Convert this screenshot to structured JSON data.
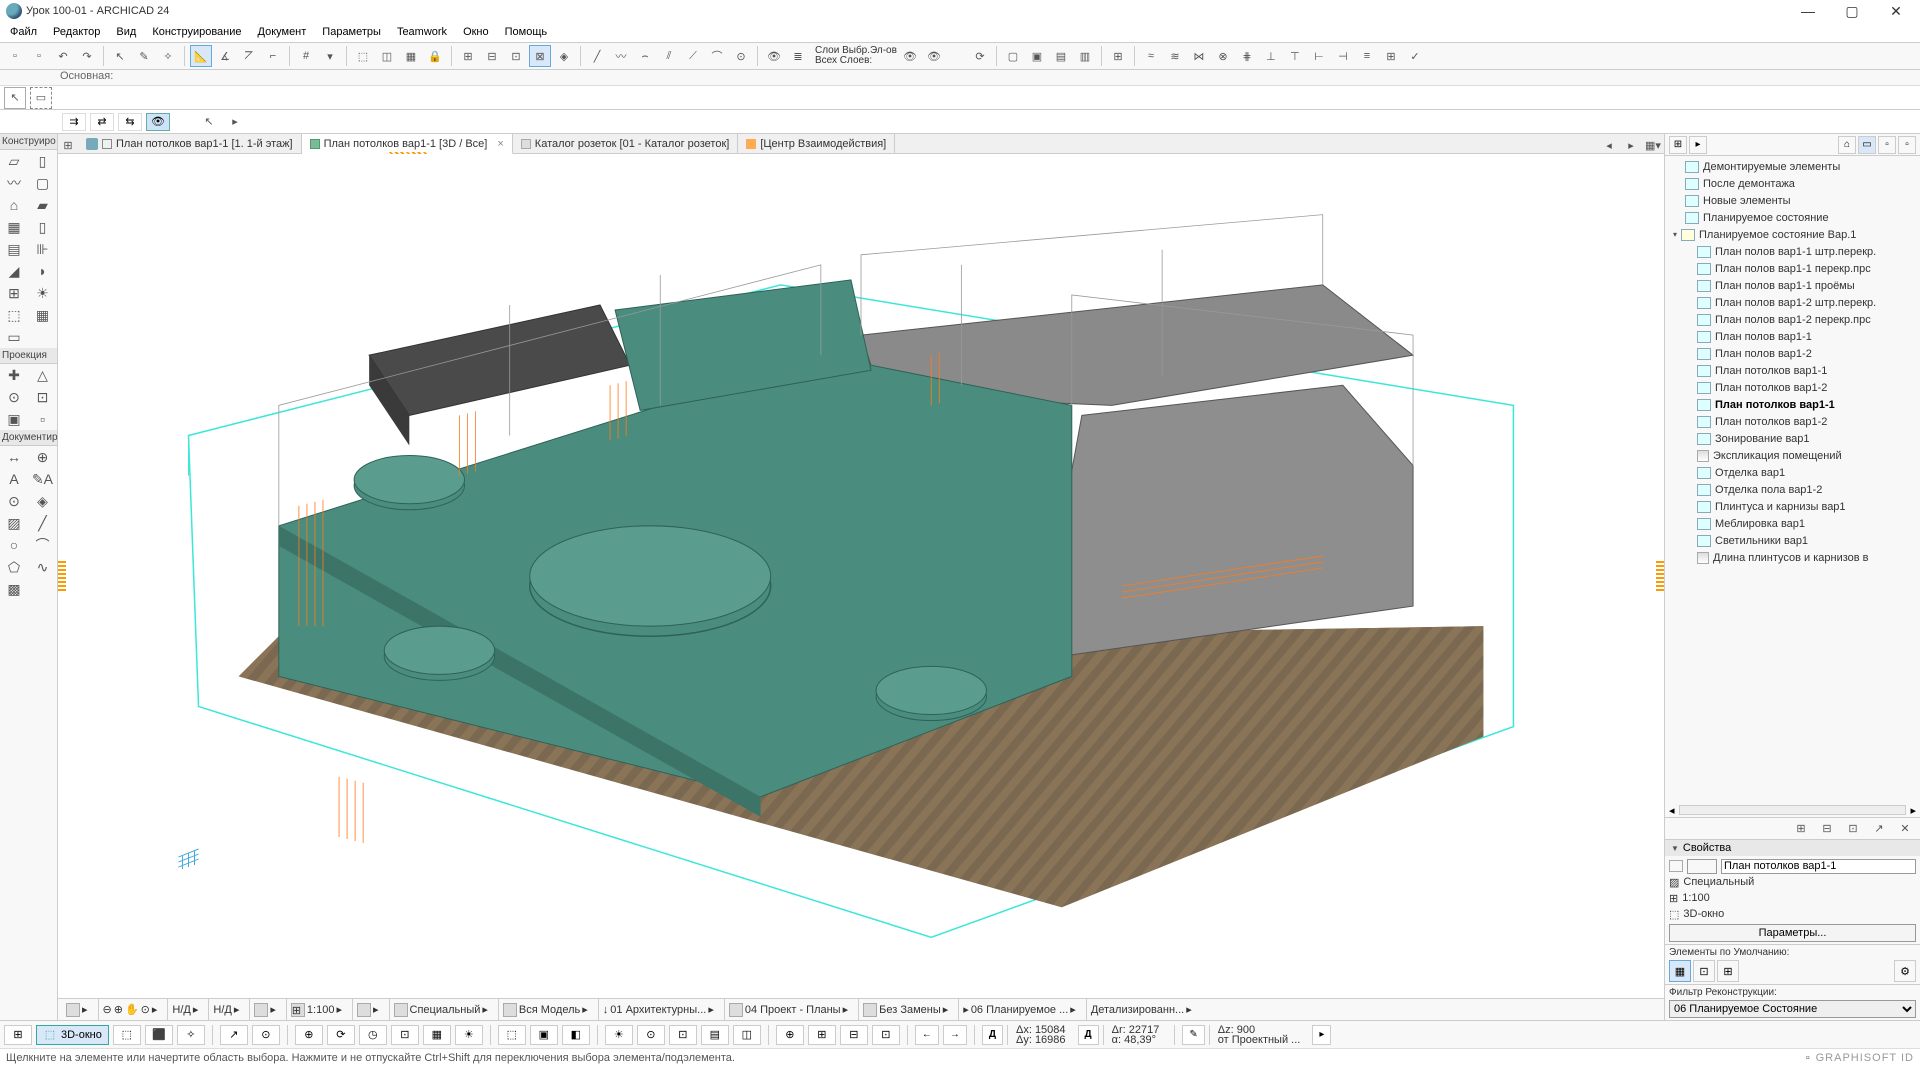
{
  "app": {
    "title": "Урок 100-01 - ARCHICAD 24"
  },
  "menu": [
    "Файл",
    "Редактор",
    "Вид",
    "Конструирование",
    "Документ",
    "Параметры",
    "Teamwork",
    "Окно",
    "Помощь"
  ],
  "toolbar_layers": {
    "l1": "Слои Выбр.Эл-ов",
    "l2": "Всех Слоев:"
  },
  "info_label": "Основная:",
  "tabs": [
    {
      "label": "План потолков вар1-1 [1. 1-й этаж]",
      "active": false
    },
    {
      "label": "План потолков вар1-1 [3D / Все]",
      "active": true
    },
    {
      "label": "Каталог розеток [01 - Каталог розеток]",
      "active": false
    },
    {
      "label": "[Центр Взаимодействия]",
      "active": false
    }
  ],
  "toolbox": {
    "section_construct": "Конструиро",
    "section_projection": "Проекция",
    "section_document": "Документир"
  },
  "navigator": {
    "items": [
      {
        "label": "Демонтируемые элементы",
        "type": "folder",
        "lvl": 2
      },
      {
        "label": "После демонтажа",
        "type": "folder",
        "lvl": 2
      },
      {
        "label": "Новые элементы",
        "type": "folder",
        "lvl": 2
      },
      {
        "label": "Планируемое состояние",
        "type": "folder",
        "lvl": 2
      },
      {
        "label": "Планируемое состояние Вар.1",
        "type": "open",
        "lvl": 1
      },
      {
        "label": "План полов вар1-1 штр.перекр.",
        "type": "folder",
        "lvl": 3
      },
      {
        "label": "План полов вар1-1 перекр.прс",
        "type": "folder",
        "lvl": 3
      },
      {
        "label": "План полов вар1-1 проёмы",
        "type": "folder",
        "lvl": 3
      },
      {
        "label": "План полов вар1-2 штр.перекр.",
        "type": "folder",
        "lvl": 3
      },
      {
        "label": "План полов вар1-2 перекр.прс",
        "type": "folder",
        "lvl": 3
      },
      {
        "label": "План полов вар1-1",
        "type": "folder",
        "lvl": 3
      },
      {
        "label": "План полов вар1-2",
        "type": "folder",
        "lvl": 3
      },
      {
        "label": "План потолков вар1-1",
        "type": "folder",
        "lvl": 3
      },
      {
        "label": "План потолков вар1-2",
        "type": "folder",
        "lvl": 3
      },
      {
        "label": "План потолков вар1-1",
        "type": "folder",
        "lvl": 3,
        "bold": true
      },
      {
        "label": "План потолков вар1-2",
        "type": "folder",
        "lvl": 3
      },
      {
        "label": "Зонирование вар1",
        "type": "folder",
        "lvl": 3
      },
      {
        "label": "Экспликация помещений",
        "type": "grid",
        "lvl": 3
      },
      {
        "label": "Отделка вар1",
        "type": "folder",
        "lvl": 3
      },
      {
        "label": "Отделка пола вар1-2",
        "type": "folder",
        "lvl": 3
      },
      {
        "label": "Плинтуса и карнизы  вар1",
        "type": "folder",
        "lvl": 3
      },
      {
        "label": "Меблировка вар1",
        "type": "folder",
        "lvl": 3
      },
      {
        "label": "Светильники вар1",
        "type": "folder",
        "lvl": 3
      },
      {
        "label": "Длина плинтусов и карнизов в",
        "type": "grid",
        "lvl": 3
      }
    ]
  },
  "properties": {
    "header": "Свойства",
    "name": "План потолков вар1-1",
    "special": "Специальный",
    "scale": "1:100",
    "window": "3D-окно",
    "params_btn": "Параметры..."
  },
  "defaults": {
    "header": "Элементы по Умолчанию:"
  },
  "filter": {
    "header": "Фильтр Реконструкции:",
    "value": "06 Планируемое Состояние"
  },
  "view_bottom": {
    "nd1": "Н/Д",
    "nd2": "Н/Д",
    "scale": "1:100",
    "special": "Специальный",
    "model": "Вся Модель",
    "arch": "01 Архитектурны...",
    "proj": "04 Проект - Планы",
    "nozamen": "Без Замены",
    "plan": "06 Планируемое ...",
    "detail": "Детализированн..."
  },
  "bottom": {
    "window3d": "3D-окно",
    "coords1a": "Δx: 15084",
    "coords1b": "Δy: 16986",
    "coords2a": "Δr: 22717",
    "coords2b": "α: 48,39°",
    "coords3a": "Δz: 900",
    "coords3b": "от Проектный ..."
  },
  "status": {
    "hint": "Щелкните на элементе или начертите область выбора. Нажмите и не отпускайте Ctrl+Shift для переключения выбора элемента/подэлемента.",
    "brand": "GRAPHISOFT ID"
  }
}
